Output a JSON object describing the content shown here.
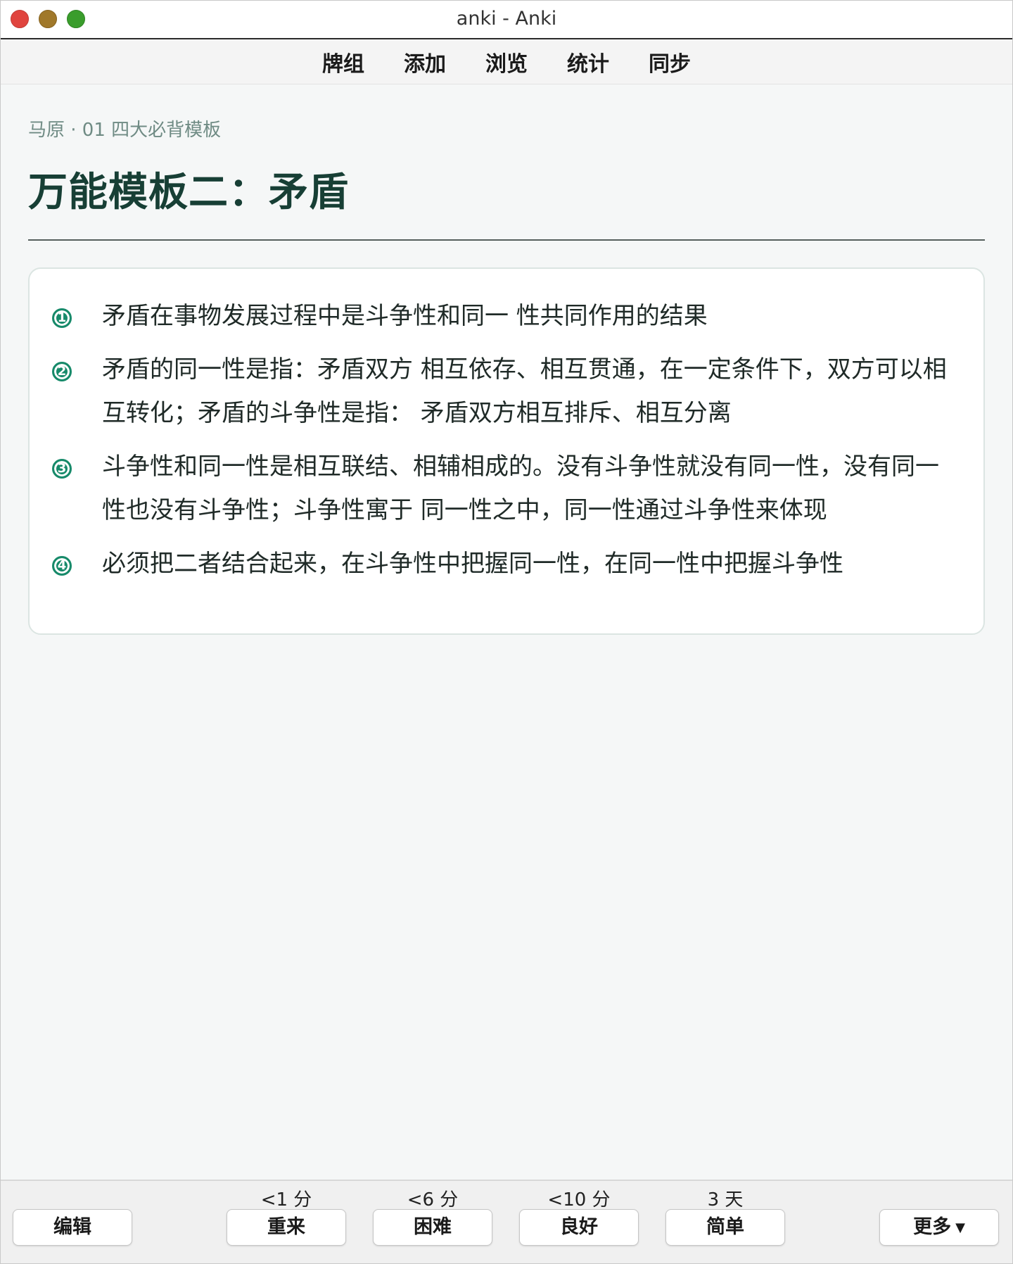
{
  "window": {
    "title": "anki - Anki"
  },
  "toolbar": {
    "items": [
      "牌组",
      "添加",
      "浏览",
      "统计",
      "同步"
    ]
  },
  "card": {
    "breadcrumb": "马原 · 01 四大必背模板",
    "title": "万能模板二：矛盾",
    "points": [
      {
        "num": "1",
        "text": "矛盾在事物发展过程中是斗争性和同一 性共同作用的结果"
      },
      {
        "num": "2",
        "text": "矛盾的同一性是指：矛盾双方 相互依存、相互贯通，在一定条件下，双方可以相互转化；矛盾的斗争性是指： 矛盾双方相互排斥、相互分离"
      },
      {
        "num": "3",
        "text": "斗争性和同一性是相互联结、相辅相成的。没有斗争性就没有同一性，没有同一性也没有斗争性；斗争性寓于 同一性之中，同一性通过斗争性来体现"
      },
      {
        "num": "4",
        "text": "必须把二者结合起来，在斗争性中把握同一性，在同一性中把握斗争性"
      }
    ]
  },
  "footer": {
    "edit_label": "编辑",
    "more_label": "更多",
    "answers": [
      {
        "interval": "<1 分",
        "label": "重来"
      },
      {
        "interval": "<6 分",
        "label": "困难"
      },
      {
        "interval": "<10 分",
        "label": "良好"
      },
      {
        "interval": "3 天",
        "label": "简单"
      }
    ]
  },
  "colors": {
    "accent": "#178a6a",
    "title": "#173f35",
    "breadcrumb": "#6f8b84",
    "background": "#f5f7f7"
  }
}
